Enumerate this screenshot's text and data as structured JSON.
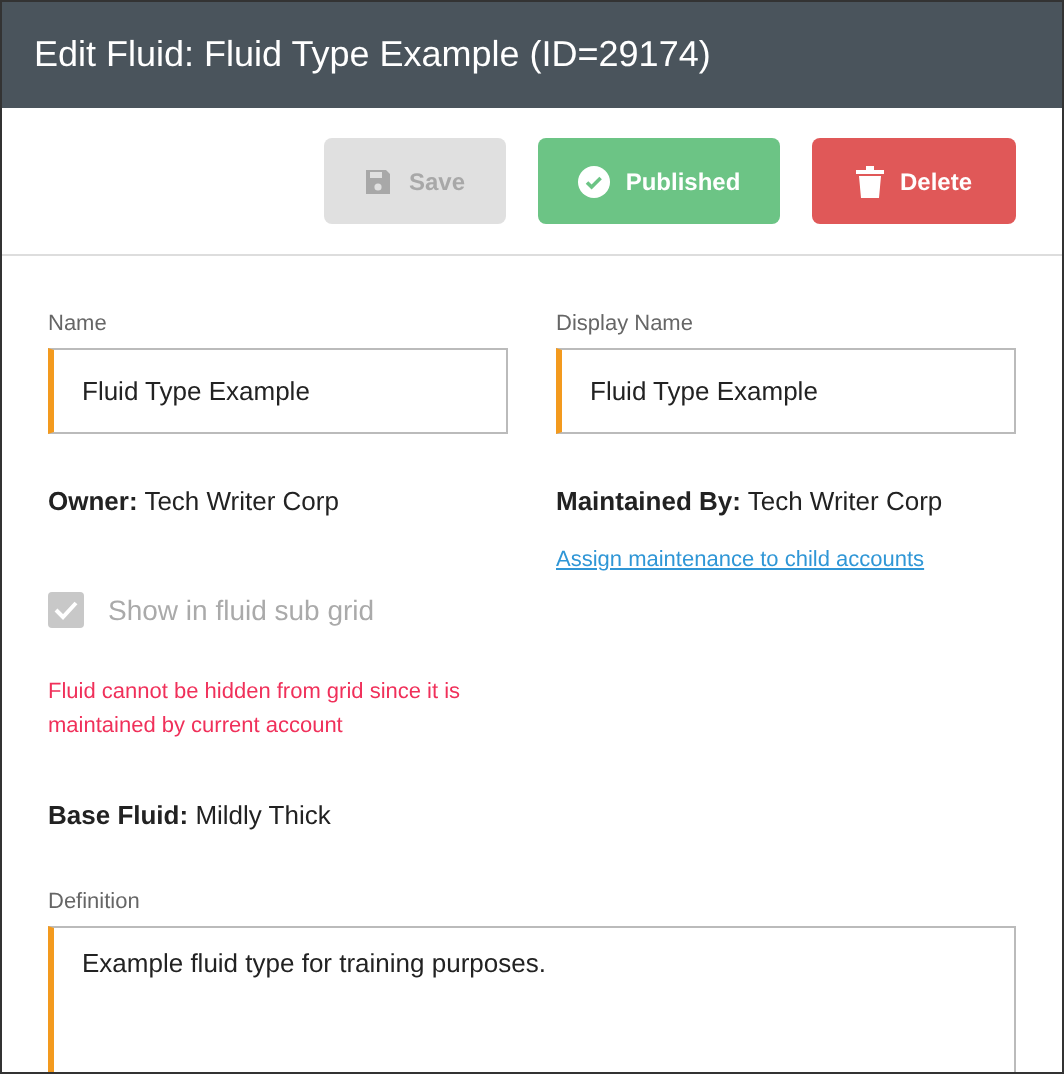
{
  "window": {
    "title": "Edit Fluid: Fluid Type Example (ID=29174)"
  },
  "toolbar": [
    {
      "kind": "save",
      "label": "Save",
      "disabled": true
    },
    {
      "kind": "published",
      "label": "Published",
      "disabled": false
    },
    {
      "kind": "delete",
      "label": "Delete",
      "disabled": false
    }
  ],
  "fields": [
    {
      "label": "Name",
      "value": "Fluid Type Example"
    },
    {
      "label": "Display Name",
      "value": "Fluid Type Example"
    }
  ],
  "owner": {
    "label": "Owner:",
    "value": "Tech Writer Corp"
  },
  "maintained_by": {
    "label": "Maintained By:",
    "value": "Tech Writer Corp"
  },
  "assign_link": "Assign maintenance to child accounts",
  "show_in_sub_grid": {
    "label": "Show in fluid sub grid",
    "checked": true,
    "disabled": true
  },
  "warning": "Fluid cannot be hidden from grid since it is maintained by current account",
  "base_fluid": {
    "label": "Base Fluid:",
    "value": "Mildly Thick"
  },
  "definition": {
    "label": "Definition",
    "value": "Example fluid type for training purposes."
  }
}
